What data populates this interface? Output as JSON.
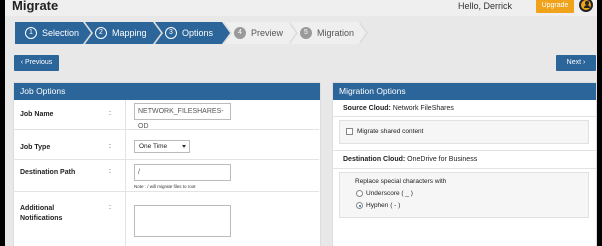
{
  "header": {
    "app_title": "Migrate",
    "greeting": "Hello, Derrick",
    "upgrade_label": "Upgrade",
    "avatar_icon": "user-avatar-icon"
  },
  "steps": [
    {
      "num": "1",
      "label": "Selection",
      "state": "active"
    },
    {
      "num": "2",
      "label": "Mapping",
      "state": "active"
    },
    {
      "num": "3",
      "label": "Options",
      "state": "active"
    },
    {
      "num": "4",
      "label": "Preview",
      "state": "inactive"
    },
    {
      "num": "5",
      "label": "Migration",
      "state": "inactive"
    }
  ],
  "nav": {
    "previous_label": "‹ Previous",
    "next_label": "Next ›"
  },
  "job_options": {
    "header": "Job Options",
    "colon": ":",
    "job_name_label": "Job Name",
    "job_name_value": "NETWORK_FILESHARES-OD",
    "job_type_label": "Job Type",
    "job_type_value": "One Time",
    "dest_path_label": "Destination Path",
    "dest_path_value": "/",
    "dest_path_note": "Note : / will migrate files to root",
    "notifications_label_1": "Additional",
    "notifications_label_2": "Notifications"
  },
  "migration_options": {
    "header": "Migration Options",
    "source_label": "Source Cloud:",
    "source_value": "Network FileShares",
    "migrate_shared_label": "Migrate shared content",
    "dest_label": "Destination Cloud:",
    "dest_value": "OneDrive for Business",
    "replace_label": "Replace special characters with",
    "underscore_label": "Underscore ( _ )",
    "hyphen_label": "Hyphen ( - )",
    "selected_replacement": "Hyphen ( - )"
  },
  "colors": {
    "accent": "#2b6599",
    "upgrade": "#f0a21a"
  }
}
